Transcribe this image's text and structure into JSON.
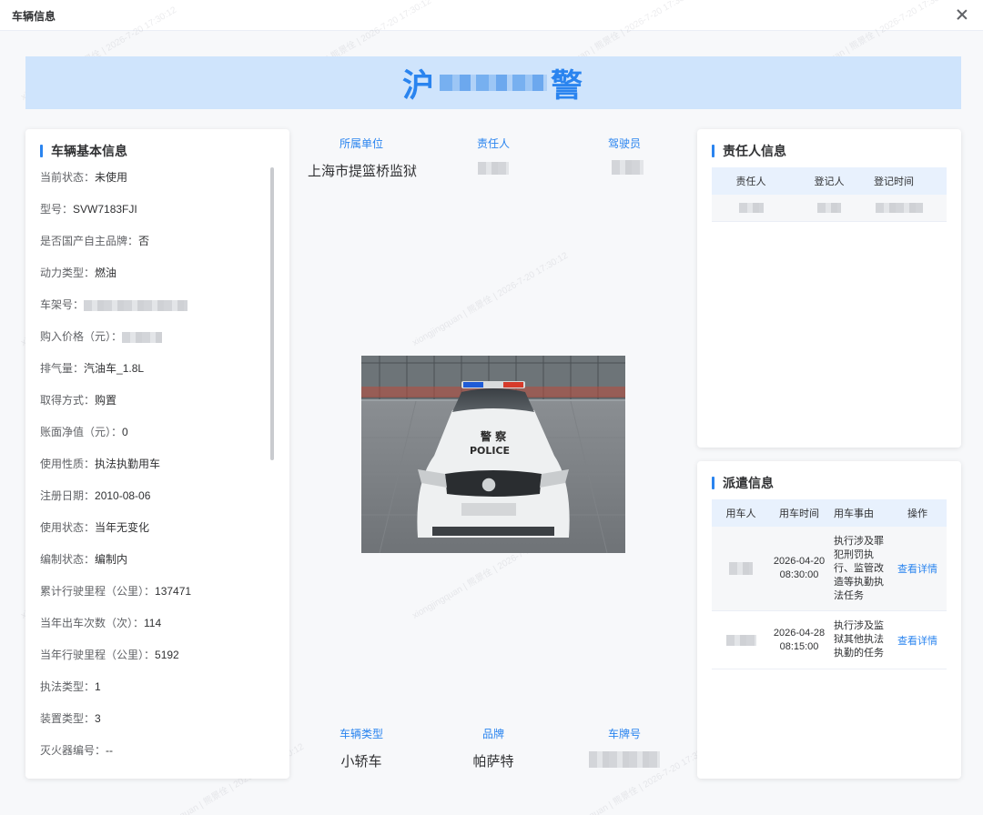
{
  "dialog": {
    "title": "车辆信息"
  },
  "plate": {
    "prefix": "沪",
    "suffix": "警"
  },
  "basic_info": {
    "title": "车辆基本信息",
    "rows": [
      {
        "key": "当前状态：",
        "value": "未使用"
      },
      {
        "key": "型号：",
        "value": "SVW7183FJI"
      },
      {
        "key": "是否国产自主品牌：",
        "value": "否"
      },
      {
        "key": "动力类型：",
        "value": "燃油"
      },
      {
        "key": "车架号：",
        "value": ""
      },
      {
        "key": "购入价格（元）：",
        "value": ""
      },
      {
        "key": "排气量：",
        "value": "汽油车_1.8L"
      },
      {
        "key": "取得方式：",
        "value": "购置"
      },
      {
        "key": "账面净值（元）：",
        "value": "0"
      },
      {
        "key": "使用性质：",
        "value": "执法执勤用车"
      },
      {
        "key": "注册日期：",
        "value": "2010-08-06"
      },
      {
        "key": "使用状态：",
        "value": "当年无变化"
      },
      {
        "key": "编制状态：",
        "value": "编制内"
      },
      {
        "key": "累计行驶里程（公里）：",
        "value": "137471"
      },
      {
        "key": "当年出车次数（次）：",
        "value": "114"
      },
      {
        "key": "当年行驶里程（公里）：",
        "value": "5192"
      },
      {
        "key": "执法类型：",
        "value": "1"
      },
      {
        "key": "装置类型：",
        "value": "3"
      },
      {
        "key": "灭火器编号：",
        "value": "--"
      }
    ]
  },
  "center": {
    "top_labels": [
      "所属单位",
      "责任人",
      "驾驶员"
    ],
    "unit_value": "上海市提篮桥监狱",
    "bottom_labels": [
      "车辆类型",
      "品牌",
      "车牌号"
    ],
    "vehicle_type": "小轿车",
    "brand": "帕萨特",
    "car_text_top": "警 察",
    "car_text_police": "POLICE"
  },
  "responsible": {
    "title": "责任人信息",
    "headers": [
      "责任人",
      "登记人",
      "登记时间"
    ]
  },
  "dispatch": {
    "title": "派遣信息",
    "headers": [
      "用车人",
      "用车时间",
      "用车事由",
      "操作"
    ],
    "rows": [
      {
        "date": "2026-04-20",
        "time": "08:30:00",
        "reason": "执行涉及罪犯刑罚执行、监管改造等执勤执法任务",
        "action": "查看详情"
      },
      {
        "date": "2026-04-28",
        "time": "08:15:00",
        "reason": "执行涉及监狱其他执法执勤的任务",
        "action": "查看详情"
      }
    ]
  },
  "colors": {
    "accent": "#2a84ef",
    "banner_bg": "#cfe4fc",
    "table_head_bg": "#e8f1fd"
  }
}
